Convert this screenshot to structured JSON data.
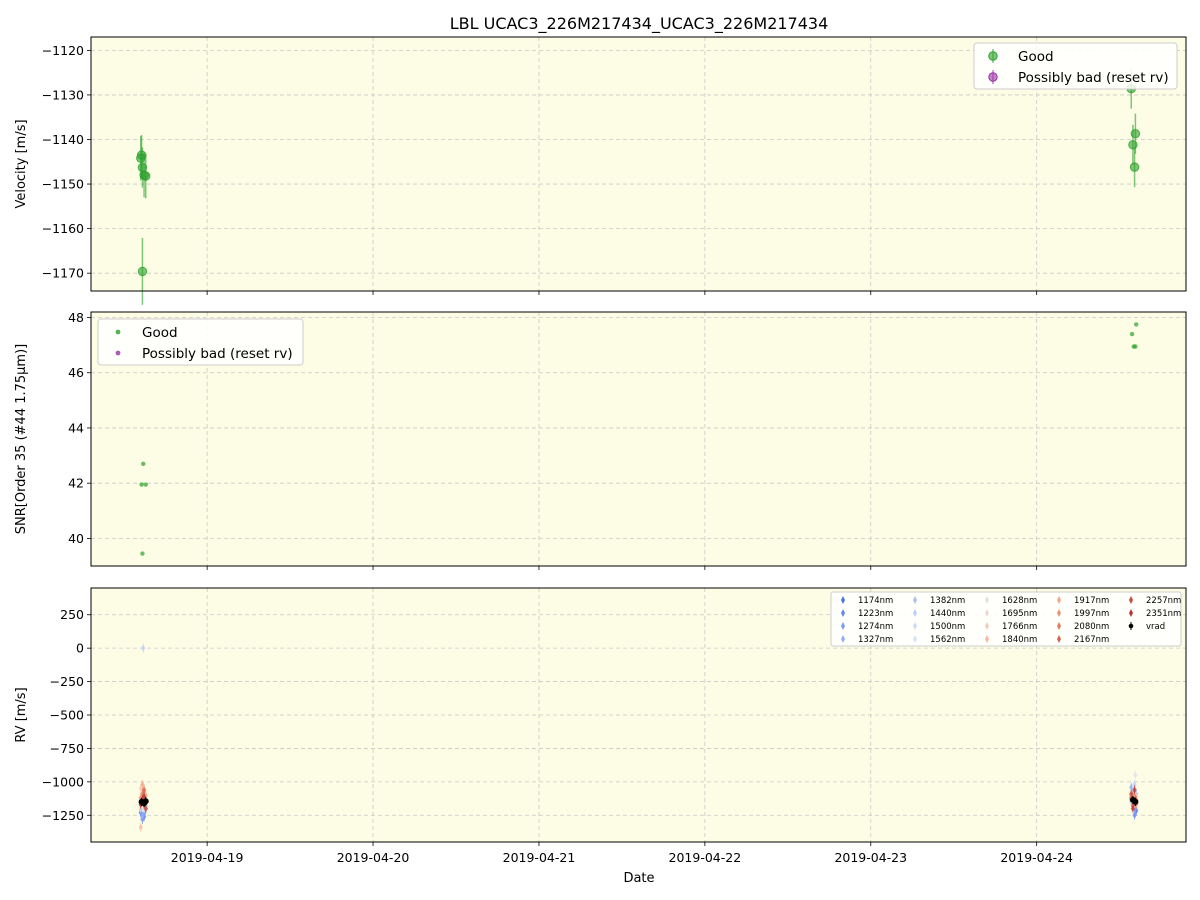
{
  "title": "LBL UCAC3_226M217434_UCAC3_226M217434",
  "colors": {
    "background": "#fdfde6",
    "good": "#2ca02c",
    "bad": "#9b30a6",
    "grid": "#c8c8c8",
    "vrad": "#000000"
  },
  "chart_data": [
    {
      "type": "scatter",
      "ylabel": "Velocity [m/s]",
      "ylim": [
        -1174,
        -1117
      ],
      "yticks": [
        -1120,
        -1130,
        -1140,
        -1150,
        -1160,
        -1170
      ],
      "legend": {
        "position": "top-right",
        "entries": [
          "Good",
          "Possibly bad (reset rv)"
        ]
      },
      "series": [
        {
          "name": "Good",
          "points": [
            {
              "x": 18.6,
              "y": -1144.2,
              "err": 5.0
            },
            {
              "x": 18.605,
              "y": -1143.5,
              "err": 4.5
            },
            {
              "x": 18.61,
              "y": -1146.3,
              "err": 4.5
            },
            {
              "x": 18.62,
              "y": -1148.0,
              "err": 5.0
            },
            {
              "x": 18.63,
              "y": -1148.2,
              "err": 5.0
            },
            {
              "x": 18.61,
              "y": -1169.6,
              "err": 7.5
            },
            {
              "x": 24.57,
              "y": -1128.6,
              "err": 4.5
            },
            {
              "x": 24.58,
              "y": -1141.2,
              "err": 4.5
            },
            {
              "x": 24.595,
              "y": -1138.7,
              "err": 4.5
            },
            {
              "x": 24.59,
              "y": -1146.2,
              "err": 4.5
            }
          ]
        },
        {
          "name": "Possibly bad (reset rv)",
          "points": []
        }
      ]
    },
    {
      "type": "scatter",
      "ylabel": "SNR[Order 35 (#44 1.75μm)]",
      "ylim": [
        39.0,
        48.2
      ],
      "yticks": [
        40,
        42,
        44,
        46,
        48
      ],
      "legend": {
        "position": "top-left",
        "entries": [
          "Good",
          "Possibly bad (reset rv)"
        ]
      },
      "series": [
        {
          "name": "Good",
          "points": [
            {
              "x": 18.605,
              "y": 41.95
            },
            {
              "x": 18.63,
              "y": 41.95
            },
            {
              "x": 18.615,
              "y": 42.7
            },
            {
              "x": 18.61,
              "y": 39.45
            },
            {
              "x": 24.575,
              "y": 47.4
            },
            {
              "x": 24.585,
              "y": 46.95
            },
            {
              "x": 24.595,
              "y": 46.95
            },
            {
              "x": 24.6,
              "y": 47.75
            }
          ]
        },
        {
          "name": "Possibly bad (reset rv)",
          "points": []
        }
      ]
    },
    {
      "type": "scatter",
      "ylabel": "RV [m/s]",
      "xlabel": "Date",
      "ylim": [
        -1450,
        450
      ],
      "yticks": [
        250,
        0,
        -250,
        -500,
        -750,
        -1000,
        -1250
      ],
      "x_tick_labels": [
        "2019-04-19",
        "2019-04-20",
        "2019-04-21",
        "2019-04-22",
        "2019-04-23",
        "2019-04-24"
      ],
      "x_ticks": [
        19,
        20,
        21,
        22,
        23,
        24
      ],
      "xlim": [
        18.3,
        24.9
      ],
      "legend": {
        "position": "top-right",
        "entries": [
          "1174nm",
          "1223nm",
          "1274nm",
          "1327nm",
          "1382nm",
          "1440nm",
          "1500nm",
          "1562nm",
          "1628nm",
          "1695nm",
          "1766nm",
          "1840nm",
          "1917nm",
          "1997nm",
          "2080nm",
          "2167nm",
          "2257nm",
          "2351nm",
          "vrad"
        ]
      },
      "band_colors": [
        "#4e72e6",
        "#6488f0",
        "#7a9cf6",
        "#90aefa",
        "#a6c0fc",
        "#bacffd",
        "#cbdbfb",
        "#d9e2f6",
        "#e6e2dc",
        "#efd9cb",
        "#f4cbb6",
        "#f5baa0",
        "#f3a789",
        "#ee9273",
        "#e67b5e",
        "#d9624b",
        "#c94c3d",
        "#b83530"
      ],
      "bands": [
        {
          "name": "1174nm",
          "points": [
            [
              18.6,
              -1230
            ],
            [
              18.62,
              -1260
            ],
            [
              24.58,
              -1170
            ],
            [
              24.6,
              -1215
            ]
          ]
        },
        {
          "name": "1223nm",
          "points": [
            [
              18.61,
              -1280
            ],
            [
              18.63,
              -1200
            ],
            [
              24.57,
              -1130
            ],
            [
              24.59,
              -1250
            ]
          ]
        },
        {
          "name": "1274nm",
          "points": [
            [
              18.6,
              -1170
            ],
            [
              18.62,
              -1240
            ],
            [
              24.58,
              -1080
            ],
            [
              24.595,
              -1200
            ]
          ]
        },
        {
          "name": "1327nm",
          "points": [
            [
              18.61,
              -1260
            ],
            [
              18.63,
              -1180
            ],
            [
              24.57,
              -1040
            ],
            [
              24.59,
              -1180
            ]
          ]
        },
        {
          "name": "1382nm",
          "points": [
            [
              18.6,
              -1210
            ],
            [
              18.62,
              -1150
            ],
            [
              24.58,
              -1120
            ],
            [
              24.6,
              -1090
            ]
          ]
        },
        {
          "name": "1440nm",
          "points": [
            [
              18.615,
              0
            ],
            [
              18.62,
              -1100
            ],
            [
              24.57,
              -1150
            ],
            [
              24.59,
              -1020
            ]
          ]
        },
        {
          "name": "1500nm",
          "points": [
            [
              18.6,
              -1140
            ],
            [
              18.63,
              -1170
            ],
            [
              24.58,
              -1070
            ],
            [
              24.595,
              -1130
            ]
          ]
        },
        {
          "name": "1562nm",
          "points": [
            [
              18.61,
              -1110
            ],
            [
              18.62,
              -1200
            ],
            [
              24.595,
              -950
            ],
            [
              24.58,
              -1110
            ]
          ]
        },
        {
          "name": "1628nm",
          "points": [
            [
              18.6,
              -1190
            ],
            [
              18.62,
              -1130
            ],
            [
              24.57,
              -1100
            ],
            [
              24.59,
              -1160
            ]
          ]
        },
        {
          "name": "1695nm",
          "points": [
            [
              18.61,
              -1060
            ],
            [
              18.63,
              -1150
            ],
            [
              24.58,
              -1140
            ],
            [
              24.6,
              -1120
            ]
          ]
        },
        {
          "name": "1766nm",
          "points": [
            [
              18.6,
              -1050
            ],
            [
              18.62,
              -1180
            ],
            [
              24.57,
              -1130
            ],
            [
              24.59,
              -1090
            ]
          ]
        },
        {
          "name": "1840nm",
          "points": [
            [
              18.6,
              -1340
            ],
            [
              18.62,
              -1080
            ],
            [
              24.58,
              -1160
            ],
            [
              24.595,
              -1100
            ]
          ]
        },
        {
          "name": "1917nm",
          "points": [
            [
              18.61,
              -1020
            ],
            [
              18.63,
              -1100
            ],
            [
              24.57,
              -1110
            ],
            [
              24.59,
              -1140
            ]
          ]
        },
        {
          "name": "1997nm",
          "points": [
            [
              18.6,
              -1120
            ],
            [
              18.62,
              -1170
            ],
            [
              24.58,
              -1100
            ],
            [
              24.6,
              -1170
            ]
          ]
        },
        {
          "name": "2080nm",
          "points": [
            [
              18.61,
              -1090
            ],
            [
              18.63,
              -1140
            ],
            [
              24.57,
              -1120
            ],
            [
              24.59,
              -1150
            ]
          ]
        },
        {
          "name": "2167nm",
          "points": [
            [
              18.6,
              -1150
            ],
            [
              18.62,
              -1060
            ],
            [
              24.58,
              -1180
            ],
            [
              24.595,
              -1130
            ]
          ]
        },
        {
          "name": "2257nm",
          "points": [
            [
              18.61,
              -1130
            ],
            [
              18.63,
              -1200
            ],
            [
              24.57,
              -1090
            ],
            [
              24.6,
              -1140
            ]
          ]
        },
        {
          "name": "2351nm",
          "points": [
            [
              18.6,
              -1170
            ],
            [
              18.62,
              -1110
            ],
            [
              24.58,
              -1200
            ],
            [
              24.59,
              -1060
            ]
          ]
        }
      ],
      "vrad": [
        [
          18.605,
          -1150
        ],
        [
          18.62,
          -1160
        ],
        [
          18.63,
          -1145
        ],
        [
          24.58,
          -1135
        ],
        [
          24.595,
          -1150
        ]
      ]
    }
  ]
}
